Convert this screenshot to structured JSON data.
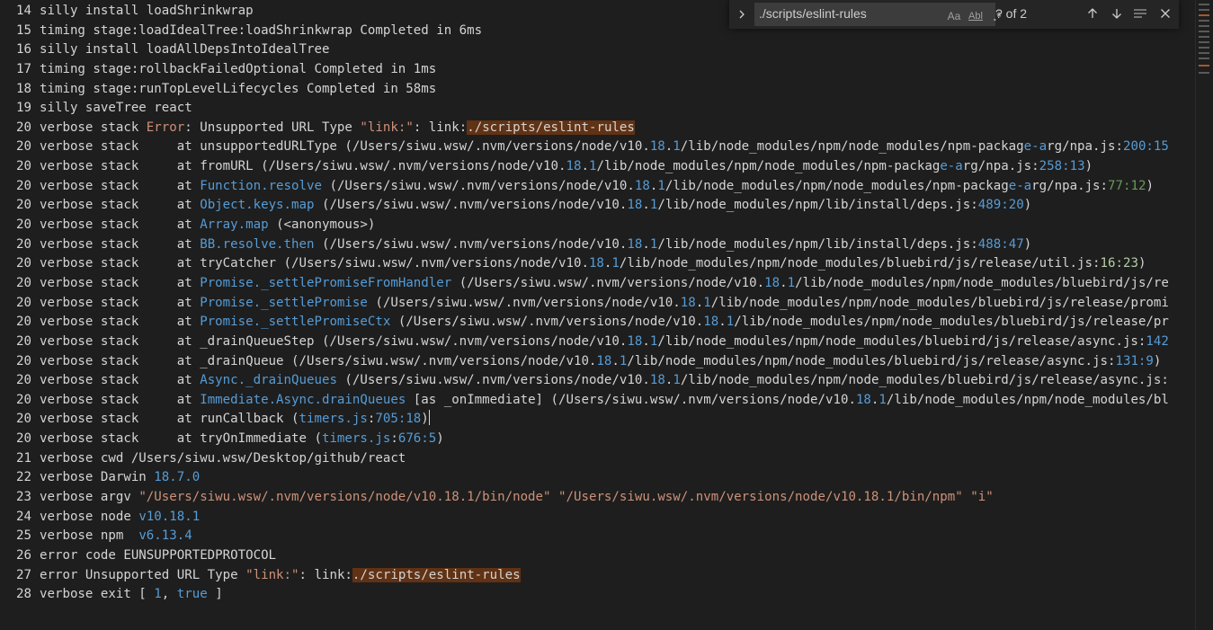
{
  "editor": {
    "lines": [
      {
        "n": "14",
        "segs": [
          {
            "t": "silly install loadShrinkwrap",
            "c": "dim"
          }
        ]
      },
      {
        "n": "15",
        "segs": [
          {
            "t": "timing stage:loadIdealTree:loadShrinkwrap Completed in 6ms",
            "c": "dim"
          }
        ]
      },
      {
        "n": "16",
        "segs": [
          {
            "t": "silly install loadAllDepsIntoIdealTree",
            "c": "dim"
          }
        ]
      },
      {
        "n": "17",
        "segs": [
          {
            "t": "timing stage:rollbackFailedOptional Completed in 1ms",
            "c": "dim"
          }
        ]
      },
      {
        "n": "18",
        "segs": [
          {
            "t": "timing stage:runTopLevelLifecycles Completed in 58ms",
            "c": "dim"
          }
        ]
      },
      {
        "n": "19",
        "segs": [
          {
            "t": "silly saveTree react",
            "c": "dim"
          }
        ]
      },
      {
        "n": "20",
        "segs": [
          {
            "t": "verbose stack ",
            "c": "dim"
          },
          {
            "t": "Error",
            "c": "err"
          },
          {
            "t": ": Unsupported URL Type ",
            "c": "dim"
          },
          {
            "t": "\"link:\"",
            "c": "str"
          },
          {
            "t": ": link:",
            "c": "dim"
          },
          {
            "t": "./scripts/eslint-rules",
            "c": "hl"
          }
        ]
      },
      {
        "n": "20",
        "segs": [
          {
            "t": "verbose stack     at unsupportedURLType (/Users/siwu.wsw/.nvm/versions/node/v10.",
            "c": "dim"
          },
          {
            "t": "18",
            "c": "num"
          },
          {
            "t": ".",
            "c": "dim"
          },
          {
            "t": "1",
            "c": "num"
          },
          {
            "t": "/lib/node_modules/npm/node_modules/npm-packag",
            "c": "dim"
          },
          {
            "t": "e-a",
            "c": "fn"
          },
          {
            "t": "rg/npa.js:",
            "c": "dim"
          },
          {
            "t": "200:15",
            "c": "num"
          }
        ]
      },
      {
        "n": "20",
        "segs": [
          {
            "t": "verbose stack     at fromURL (/Users/siwu.wsw/.nvm/versions/node/v10.",
            "c": "dim"
          },
          {
            "t": "18",
            "c": "num"
          },
          {
            "t": ".",
            "c": "dim"
          },
          {
            "t": "1",
            "c": "num"
          },
          {
            "t": "/lib/node_modules/npm/node_modules/npm-packag",
            "c": "dim"
          },
          {
            "t": "e-a",
            "c": "fn"
          },
          {
            "t": "rg/npa.js:",
            "c": "dim"
          },
          {
            "t": "258:13",
            "c": "num"
          },
          {
            "t": ")",
            "c": "dim"
          }
        ]
      },
      {
        "n": "20",
        "segs": [
          {
            "t": "verbose stack     at ",
            "c": "dim"
          },
          {
            "t": "Function.resolve",
            "c": "fn"
          },
          {
            "t": " (/Users/siwu.wsw/.nvm/versions/node/v10.",
            "c": "dim"
          },
          {
            "t": "18",
            "c": "num"
          },
          {
            "t": ".",
            "c": "dim"
          },
          {
            "t": "1",
            "c": "num"
          },
          {
            "t": "/lib/node_modules/npm/node_modules/npm-packag",
            "c": "dim"
          },
          {
            "t": "e-a",
            "c": "fn"
          },
          {
            "t": "rg/npa.js:",
            "c": "dim"
          },
          {
            "t": "77:12",
            "c": "grn"
          },
          {
            "t": ")",
            "c": "dim"
          }
        ]
      },
      {
        "n": "20",
        "segs": [
          {
            "t": "verbose stack     at ",
            "c": "dim"
          },
          {
            "t": "Object.keys.map",
            "c": "fn"
          },
          {
            "t": " (/Users/siwu.wsw/.nvm/versions/node/v10.",
            "c": "dim"
          },
          {
            "t": "18",
            "c": "num"
          },
          {
            "t": ".",
            "c": "dim"
          },
          {
            "t": "1",
            "c": "num"
          },
          {
            "t": "/lib/node_modules/npm/lib/install/deps.js:",
            "c": "dim"
          },
          {
            "t": "489:20",
            "c": "num"
          },
          {
            "t": ")",
            "c": "dim"
          }
        ]
      },
      {
        "n": "20",
        "segs": [
          {
            "t": "verbose stack     at ",
            "c": "dim"
          },
          {
            "t": "Array.map",
            "c": "fn"
          },
          {
            "t": " (<anonymous>)",
            "c": "dim"
          }
        ]
      },
      {
        "n": "20",
        "segs": [
          {
            "t": "verbose stack     at ",
            "c": "dim"
          },
          {
            "t": "BB.resolve.then",
            "c": "fn"
          },
          {
            "t": " (/Users/siwu.wsw/.nvm/versions/node/v10.",
            "c": "dim"
          },
          {
            "t": "18",
            "c": "num"
          },
          {
            "t": ".",
            "c": "dim"
          },
          {
            "t": "1",
            "c": "num"
          },
          {
            "t": "/lib/node_modules/npm/lib/install/deps.js:",
            "c": "dim"
          },
          {
            "t": "488:47",
            "c": "num"
          },
          {
            "t": ")",
            "c": "dim"
          }
        ]
      },
      {
        "n": "20",
        "segs": [
          {
            "t": "verbose stack     at tryCatcher (/Users/siwu.wsw/.nvm/versions/node/v10.",
            "c": "dim"
          },
          {
            "t": "18",
            "c": "num"
          },
          {
            "t": ".",
            "c": "dim"
          },
          {
            "t": "1",
            "c": "num"
          },
          {
            "t": "/lib/node_modules/npm/node_modules/bluebird/js/release/util.js:",
            "c": "dim"
          },
          {
            "t": "16:23",
            "c": "num2"
          },
          {
            "t": ")",
            "c": "dim"
          }
        ]
      },
      {
        "n": "20",
        "segs": [
          {
            "t": "verbose stack     at ",
            "c": "dim"
          },
          {
            "t": "Promise._settlePromiseFromHandler",
            "c": "fn"
          },
          {
            "t": " (/Users/siwu.wsw/.nvm/versions/node/v10.",
            "c": "dim"
          },
          {
            "t": "18",
            "c": "num"
          },
          {
            "t": ".",
            "c": "dim"
          },
          {
            "t": "1",
            "c": "num"
          },
          {
            "t": "/lib/node_modules/npm/node_modules/bluebird/js/re",
            "c": "dim"
          }
        ]
      },
      {
        "n": "20",
        "segs": [
          {
            "t": "verbose stack     at ",
            "c": "dim"
          },
          {
            "t": "Promise._settlePromise",
            "c": "fn"
          },
          {
            "t": " (/Users/siwu.wsw/.nvm/versions/node/v10.",
            "c": "dim"
          },
          {
            "t": "18",
            "c": "num"
          },
          {
            "t": ".",
            "c": "dim"
          },
          {
            "t": "1",
            "c": "num"
          },
          {
            "t": "/lib/node_modules/npm/node_modules/bluebird/js/release/promi",
            "c": "dim"
          }
        ]
      },
      {
        "n": "20",
        "segs": [
          {
            "t": "verbose stack     at ",
            "c": "dim"
          },
          {
            "t": "Promise._settlePromiseCtx",
            "c": "fn"
          },
          {
            "t": " (/Users/siwu.wsw/.nvm/versions/node/v10.",
            "c": "dim"
          },
          {
            "t": "18",
            "c": "num"
          },
          {
            "t": ".",
            "c": "dim"
          },
          {
            "t": "1",
            "c": "num"
          },
          {
            "t": "/lib/node_modules/npm/node_modules/bluebird/js/release/pr",
            "c": "dim"
          }
        ]
      },
      {
        "n": "20",
        "segs": [
          {
            "t": "verbose stack     at _drainQueueStep (/Users/siwu.wsw/.nvm/versions/node/v10.",
            "c": "dim"
          },
          {
            "t": "18",
            "c": "num"
          },
          {
            "t": ".",
            "c": "dim"
          },
          {
            "t": "1",
            "c": "num"
          },
          {
            "t": "/lib/node_modules/npm/node_modules/bluebird/js/release/async.js:",
            "c": "dim"
          },
          {
            "t": "142",
            "c": "num"
          }
        ]
      },
      {
        "n": "20",
        "segs": [
          {
            "t": "verbose stack     at _drainQueue (/Users/siwu.wsw/.nvm/versions/node/v10.",
            "c": "dim"
          },
          {
            "t": "18",
            "c": "num"
          },
          {
            "t": ".",
            "c": "dim"
          },
          {
            "t": "1",
            "c": "num"
          },
          {
            "t": "/lib/node_modules/npm/node_modules/bluebird/js/release/async.js:",
            "c": "dim"
          },
          {
            "t": "131:9",
            "c": "num"
          },
          {
            "t": ")",
            "c": "dim"
          }
        ]
      },
      {
        "n": "20",
        "segs": [
          {
            "t": "verbose stack     at ",
            "c": "dim"
          },
          {
            "t": "Async._drainQueues",
            "c": "fn"
          },
          {
            "t": " (/Users/siwu.wsw/.nvm/versions/node/v10.",
            "c": "dim"
          },
          {
            "t": "18",
            "c": "num"
          },
          {
            "t": ".",
            "c": "dim"
          },
          {
            "t": "1",
            "c": "num"
          },
          {
            "t": "/lib/node_modules/npm/node_modules/bluebird/js/release/async.js:",
            "c": "dim"
          }
        ]
      },
      {
        "n": "20",
        "segs": [
          {
            "t": "verbose stack     at ",
            "c": "dim"
          },
          {
            "t": "Immediate.Async.drainQueues",
            "c": "fn"
          },
          {
            "t": " [as _onImmediate] (/Users/siwu.wsw/.nvm/versions/node/v10.",
            "c": "dim"
          },
          {
            "t": "18",
            "c": "num"
          },
          {
            "t": ".",
            "c": "dim"
          },
          {
            "t": "1",
            "c": "num"
          },
          {
            "t": "/lib/node_modules/npm/node_modules/bl",
            "c": "dim"
          }
        ]
      },
      {
        "n": "20",
        "cursor": true,
        "segs": [
          {
            "t": "verbose stack     at runCallback (",
            "c": "dim"
          },
          {
            "t": "timers.js",
            "c": "fn"
          },
          {
            "t": ":",
            "c": "dim"
          },
          {
            "t": "705:18",
            "c": "num"
          },
          {
            "t": ")",
            "c": "dim"
          }
        ]
      },
      {
        "n": "20",
        "segs": [
          {
            "t": "verbose stack     at tryOnImmediate (",
            "c": "dim"
          },
          {
            "t": "timers.js",
            "c": "fn"
          },
          {
            "t": ":",
            "c": "dim"
          },
          {
            "t": "676:5",
            "c": "num"
          },
          {
            "t": ")",
            "c": "dim"
          }
        ]
      },
      {
        "n": "21",
        "segs": [
          {
            "t": "verbose cwd /Users/siwu.wsw/Desktop/github/react",
            "c": "dim"
          }
        ]
      },
      {
        "n": "22",
        "segs": [
          {
            "t": "verbose Darwin ",
            "c": "dim"
          },
          {
            "t": "18.7.0",
            "c": "num"
          }
        ]
      },
      {
        "n": "23",
        "segs": [
          {
            "t": "verbose argv ",
            "c": "dim"
          },
          {
            "t": "\"/Users/siwu.wsw/.nvm/versions/node/v10.18.1/bin/node\"",
            "c": "str"
          },
          {
            "t": " ",
            "c": "dim"
          },
          {
            "t": "\"/Users/siwu.wsw/.nvm/versions/node/v10.18.1/bin/npm\"",
            "c": "str"
          },
          {
            "t": " ",
            "c": "dim"
          },
          {
            "t": "\"i\"",
            "c": "str"
          }
        ]
      },
      {
        "n": "24",
        "segs": [
          {
            "t": "verbose node ",
            "c": "dim"
          },
          {
            "t": "v10.18.1",
            "c": "num"
          }
        ]
      },
      {
        "n": "25",
        "segs": [
          {
            "t": "verbose npm  ",
            "c": "dim"
          },
          {
            "t": "v6.13.4",
            "c": "num"
          }
        ]
      },
      {
        "n": "26",
        "segs": [
          {
            "t": "error code EUNSUPPORTEDPROTOCOL",
            "c": "dim"
          }
        ]
      },
      {
        "n": "27",
        "segs": [
          {
            "t": "error Unsupported URL Type ",
            "c": "dim"
          },
          {
            "t": "\"link:\"",
            "c": "str"
          },
          {
            "t": ": link:",
            "c": "dim"
          },
          {
            "t": "./scripts/eslint-rules",
            "c": "hl"
          }
        ]
      },
      {
        "n": "28",
        "segs": [
          {
            "t": "verbose exit [ ",
            "c": "dim"
          },
          {
            "t": "1",
            "c": "num"
          },
          {
            "t": ", ",
            "c": "dim"
          },
          {
            "t": "true",
            "c": "kw"
          },
          {
            "t": " ]",
            "c": "dim"
          }
        ]
      }
    ]
  },
  "find": {
    "query": "./scripts/eslint-rules",
    "match_case_label": "Aa",
    "whole_word_label": "Abl",
    "regex_label": ".*",
    "result_count": "? of 2",
    "toggle_icon": "chevron-right-icon",
    "prev_icon": "arrow-up-icon",
    "next_icon": "arrow-down-icon",
    "selection_icon": "find-in-selection-icon",
    "close_icon": "close-icon"
  },
  "colors": {
    "background": "#1e1e1e",
    "text": "#d4d4d4",
    "string": "#ce9178",
    "number": "#569cd6",
    "match_highlight": "#613214",
    "find_widget_bg": "#252526"
  }
}
